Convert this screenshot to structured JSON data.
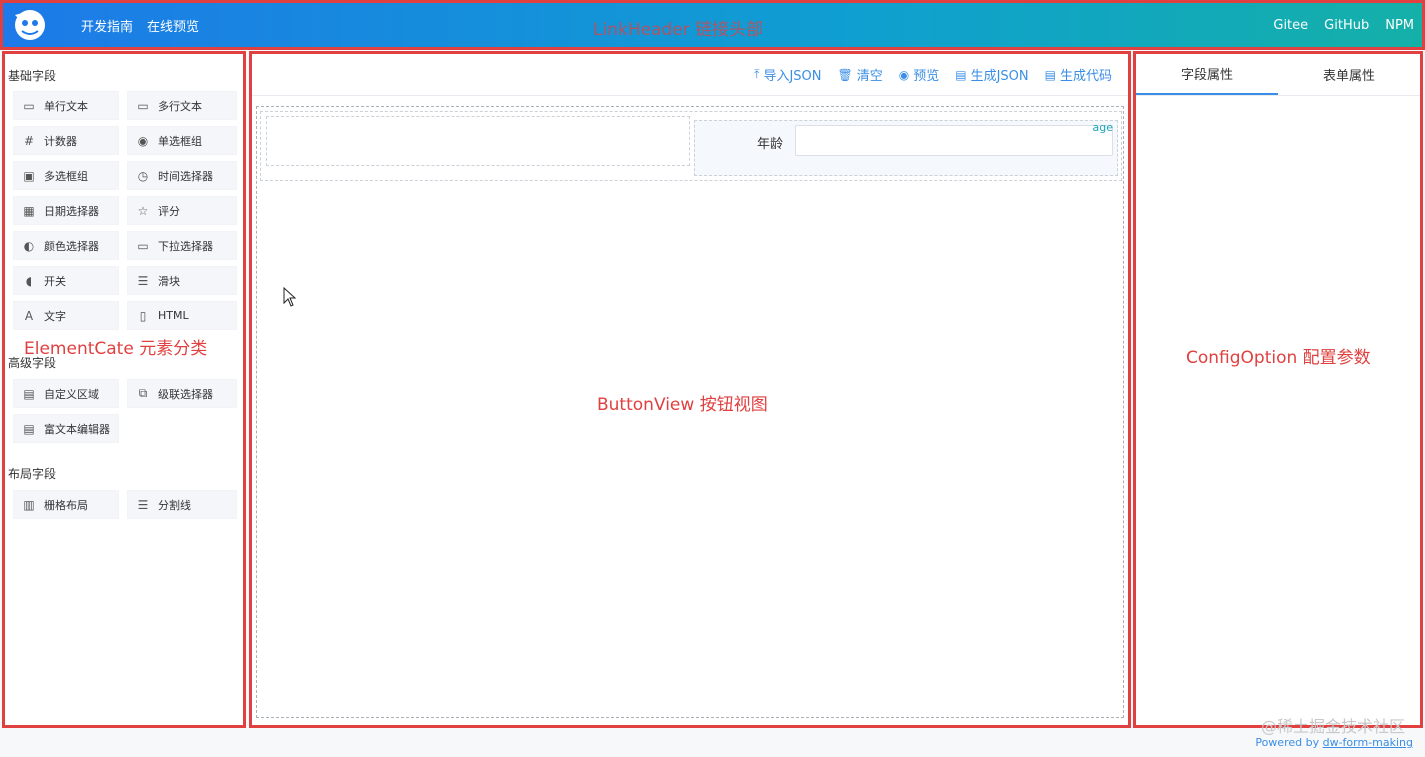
{
  "header": {
    "nav": [
      "开发指南",
      "在线预览"
    ],
    "center_label": "LinkHeader 链接头部",
    "links": [
      "Gitee",
      "GitHub",
      "NPM"
    ]
  },
  "left": {
    "basic_title": "基础字段",
    "basic_items": [
      {
        "label": "单行文本",
        "icon": "input-icon"
      },
      {
        "label": "多行文本",
        "icon": "textarea-icon"
      },
      {
        "label": "计数器",
        "icon": "number-icon"
      },
      {
        "label": "单选框组",
        "icon": "radio-icon"
      },
      {
        "label": "多选框组",
        "icon": "checkbox-icon"
      },
      {
        "label": "时间选择器",
        "icon": "clock-icon"
      },
      {
        "label": "日期选择器",
        "icon": "calendar-icon"
      },
      {
        "label": "评分",
        "icon": "star-icon"
      },
      {
        "label": "颜色选择器",
        "icon": "palette-icon"
      },
      {
        "label": "下拉选择器",
        "icon": "select-icon"
      },
      {
        "label": "开关",
        "icon": "switch-icon"
      },
      {
        "label": "滑块",
        "icon": "slider-icon"
      },
      {
        "label": "文字",
        "icon": "text-icon"
      },
      {
        "label": "HTML",
        "icon": "html-icon"
      }
    ],
    "advanced_title": "高级字段",
    "advanced_items": [
      {
        "label": "自定义区域",
        "icon": "custom-icon"
      },
      {
        "label": "级联选择器",
        "icon": "cascader-icon"
      },
      {
        "label": "富文本编辑器",
        "icon": "editor-icon"
      }
    ],
    "layout_title": "布局字段",
    "layout_items": [
      {
        "label": "栅格布局",
        "icon": "grid-icon"
      },
      {
        "label": "分割线",
        "icon": "divider-icon"
      }
    ],
    "annotation": "ElementCate 元素分类"
  },
  "toolbar": {
    "import": "导入JSON",
    "clear": "清空",
    "preview": "预览",
    "gen_json": "生成JSON",
    "gen_code": "生成代码"
  },
  "canvas": {
    "field_label": "年龄",
    "field_model": "age",
    "annotation": "ButtonView 按钮视图"
  },
  "config": {
    "tabs": [
      "字段属性",
      "表单属性"
    ],
    "annotation": "ConfigOption 配置参数"
  },
  "footer": {
    "watermark": "@稀土掘金技术社区",
    "powered_prefix": "Powered by ",
    "powered_link": "dw-form-making"
  },
  "colors": {
    "accent": "#3a8ee6",
    "annotation": "#e04040"
  }
}
